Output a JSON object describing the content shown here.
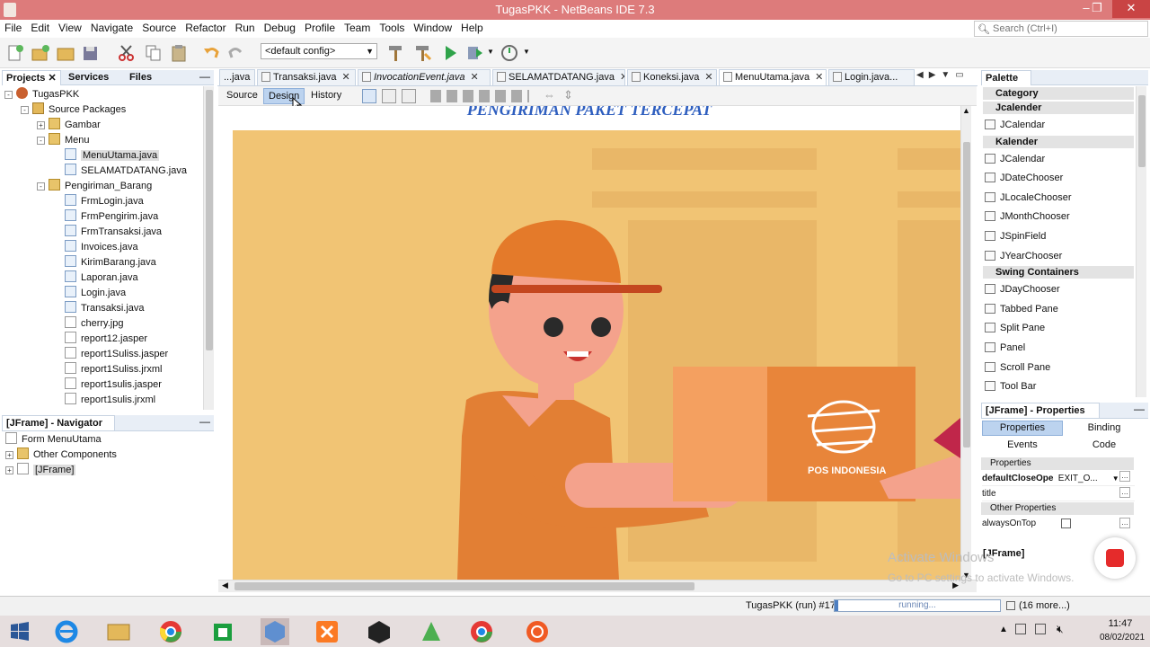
{
  "window": {
    "title": "TugasPKK - NetBeans IDE 7.3",
    "controls": [
      "–",
      "❐",
      "✕"
    ]
  },
  "menu": [
    "File",
    "Edit",
    "View",
    "Navigate",
    "Source",
    "Refactor",
    "Run",
    "Debug",
    "Profile",
    "Team",
    "Tools",
    "Window",
    "Help"
  ],
  "search": {
    "placeholder": "Search (Ctrl+I)"
  },
  "toolbar": {
    "config_value": "<default config>"
  },
  "projects_panel": {
    "tabs": [
      "Projects",
      "Services",
      "Files"
    ],
    "tree": [
      {
        "label": "TugasPKK",
        "type": "proj",
        "depth": 0,
        "exp": "-"
      },
      {
        "label": "Source Packages",
        "type": "src",
        "depth": 1,
        "exp": "-"
      },
      {
        "label": "Gambar",
        "type": "pkg",
        "depth": 2,
        "exp": "+"
      },
      {
        "label": "Menu",
        "type": "pkg",
        "depth": 2,
        "exp": "-"
      },
      {
        "label": "MenuUtama.java",
        "type": "java",
        "depth": 3,
        "selected": true
      },
      {
        "label": "SELAMATDATANG.java",
        "type": "java",
        "depth": 3
      },
      {
        "label": "Pengiriman_Barang",
        "type": "pkg",
        "depth": 2,
        "exp": "-"
      },
      {
        "label": "FrmLogin.java",
        "type": "java",
        "depth": 3
      },
      {
        "label": "FrmPengirim.java",
        "type": "java",
        "depth": 3
      },
      {
        "label": "FrmTransaksi.java",
        "type": "java",
        "depth": 3
      },
      {
        "label": "Invoices.java",
        "type": "java",
        "depth": 3
      },
      {
        "label": "KirimBarang.java",
        "type": "java",
        "depth": 3
      },
      {
        "label": "Laporan.java",
        "type": "java",
        "depth": 3
      },
      {
        "label": "Login.java",
        "type": "java",
        "depth": 3
      },
      {
        "label": "Transaksi.java",
        "type": "java",
        "depth": 3
      },
      {
        "label": "cherry.jpg",
        "type": "file",
        "depth": 3
      },
      {
        "label": "report12.jasper",
        "type": "file",
        "depth": 3
      },
      {
        "label": "report1Suliss.jasper",
        "type": "file",
        "depth": 3
      },
      {
        "label": "report1Suliss.jrxml",
        "type": "file",
        "depth": 3
      },
      {
        "label": "report1sulis.jasper",
        "type": "file",
        "depth": 3
      },
      {
        "label": "report1sulis.jrxml",
        "type": "file",
        "depth": 3
      }
    ]
  },
  "navigator_panel": {
    "title": "[JFrame] - Navigator",
    "items": [
      "Form MenuUtama",
      "Other Components",
      "[JFrame]"
    ]
  },
  "editor": {
    "tabs": [
      {
        "label": "...java",
        "active": false,
        "italic": false
      },
      {
        "label": "Transaksi.java",
        "active": false,
        "italic": false
      },
      {
        "label": "InvocationEvent.java",
        "active": false,
        "italic": true
      },
      {
        "label": "SELAMATDATANG.java",
        "active": false,
        "italic": false
      },
      {
        "label": "Koneksi.java",
        "active": false,
        "italic": false
      },
      {
        "label": "MenuUtama.java",
        "active": true,
        "italic": false
      },
      {
        "label": "Login.java...",
        "active": false,
        "italic": false
      }
    ],
    "view_tabs": [
      "Source",
      "Design",
      "History"
    ],
    "active_view": "Design",
    "canvas_heading": "PENGIRIMAN PAKET TERCEPAT",
    "box_logo_text": "POS INDONESIA"
  },
  "palette": {
    "title": "Palette",
    "sections": [
      {
        "name": "Category",
        "items": []
      },
      {
        "name": "Jcalender",
        "items": [
          "JCalendar"
        ]
      },
      {
        "name": "Kalender",
        "items": [
          "JCalendar",
          "JDateChooser",
          "JLocaleChooser",
          "JMonthChooser",
          "JSpinField",
          "JYearChooser"
        ]
      },
      {
        "name": "Swing Containers",
        "items": [
          "JDayChooser",
          "Tabbed Pane",
          "Split Pane",
          "Panel",
          "Scroll Pane",
          "Tool Bar"
        ]
      }
    ]
  },
  "properties_panel": {
    "title": "[JFrame] - Properties",
    "tabs": [
      "Properties",
      "Binding",
      "Events",
      "Code"
    ],
    "section1": "Properties",
    "rows": [
      {
        "name": "defaultCloseOpe",
        "value": "EXIT_O..."
      },
      {
        "name": "title",
        "value": ""
      }
    ],
    "section2": "Other Properties",
    "rows2": [
      {
        "name": "alwaysOnTop",
        "value": ""
      }
    ],
    "footer": "[JFrame]"
  },
  "watermark": {
    "line1": "Activate Windows",
    "line2": "Go to PC settings to activate Windows."
  },
  "status": {
    "run_label": "TugasPKK (run) #17",
    "progress_text": "running...",
    "more": "(16 more...)"
  },
  "taskbar": {
    "time": "11:47",
    "date": "08/02/2021"
  },
  "colors": {
    "titlebar": "#dd7b7b",
    "accent": "#2f5fbf",
    "canvas_bg": "#f1c474",
    "cap": "#e47a2a",
    "shirt": "#e27f34"
  }
}
